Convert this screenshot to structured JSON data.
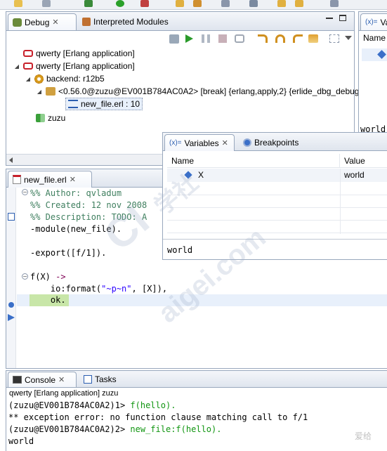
{
  "debug_view": {
    "tab_debug": "Debug",
    "tab_interpreted": "Interpreted Modules",
    "tree": [
      {
        "label": "qwerty [Erlang application]"
      },
      {
        "label": "qwerty [Erlang application]"
      },
      {
        "label": "backend: r12b5"
      },
      {
        "label": "<0.56.0@zuzu@EV001B784AC0A2> [break] {erlang,apply,2} {erlide_dbg_debugg"
      },
      {
        "label": "new_file.erl : 10"
      },
      {
        "label": "zuzu"
      }
    ]
  },
  "right_view": {
    "tab_label": "Va",
    "name_header": "Name",
    "partial_text": "world"
  },
  "editor": {
    "tab_label": "new_file.erl",
    "lines": {
      "l1": "%% Author: qvladum",
      "l2": "%% Created: 12 nov 2008",
      "l3": "%% Description: TODO: A",
      "l4": "-module(new_file).",
      "l5": "-export([f/1]).",
      "l6_kw": "f(X) ",
      "l6_arrow": "->",
      "l7_pre": "    io:format(",
      "l7_str": "\"~p~n\"",
      "l7_post": ", [X]),",
      "l8": "    ok."
    }
  },
  "variables": {
    "tab_variables": "Variables",
    "tab_breakpoints": "Breakpoints",
    "col_name": "Name",
    "col_value": "Value",
    "rows": [
      {
        "name": "X",
        "value": "world"
      }
    ],
    "detail": "world"
  },
  "console": {
    "tab_console": "Console",
    "tab_tasks": "Tasks",
    "header": "qwerty [Erlang application] zuzu",
    "l1_prompt": "(zuzu@EV001B784AC0A2)1> ",
    "l1_input": "f(hello).",
    "l2": "** exception error: no function clause matching call to f/1",
    "l3_prompt": "(zuzu@EV001B784AC0A2)2> ",
    "l3_input": "new_file:f(hello).",
    "l4": "world"
  },
  "watermark": {
    "text1": "CI",
    "text2": "学社",
    "text3": "aigei.com",
    "corner": "爱给"
  },
  "colors": {
    "highlight_line": "#c8e6a8",
    "current_line": "#e8f0fb",
    "comment": "#3f7f5f",
    "string": "#2a00ff",
    "console_input": "#129612",
    "panel_border": "#99a8bd"
  }
}
